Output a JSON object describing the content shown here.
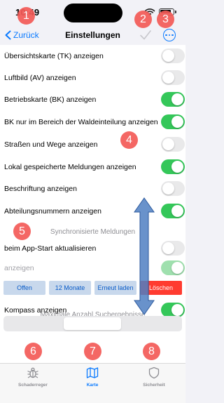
{
  "status_bar": {
    "time": "10:49"
  },
  "nav": {
    "back_label": "Zurück",
    "title": "Einstellungen"
  },
  "settings": [
    {
      "label": "Übersichtskarte (TK) anzeigen",
      "on": false
    },
    {
      "label": "Luftbild (AV) anzeigen",
      "on": false
    },
    {
      "label": "Betriebskarte (BK) anzeigen",
      "on": true
    },
    {
      "label": "BK nur im Bereich der Waldeinteilung anzeigen",
      "on": true
    },
    {
      "label": "Straßen und Wege anzeigen",
      "on": false
    },
    {
      "label": "Lokal gespeicherte Meldungen anzeigen",
      "on": true
    },
    {
      "label": "Beschriftung anzeigen",
      "on": false
    },
    {
      "label": "Abteilungsnummern anzeigen",
      "on": true
    }
  ],
  "sync": {
    "header": "Synchronisierte Meldungen",
    "rows": [
      {
        "label": "beim App-Start aktualisieren",
        "on": false
      },
      {
        "label": "anzeigen",
        "on": true
      }
    ],
    "buttons": [
      "Offen",
      "12 Monate",
      "Erneut laden",
      "Löschen"
    ]
  },
  "compass": {
    "label": "Kompass anzeigen",
    "on": true
  },
  "search_results": {
    "header": "Maximale Anzahl Suchergebnisse",
    "selected_index": 1
  },
  "tabs": [
    {
      "label": "Schaderreger",
      "icon": "bug-icon"
    },
    {
      "label": "Karte",
      "icon": "map-icon",
      "active": true
    },
    {
      "label": "Sicherheit",
      "icon": "shield-icon"
    }
  ],
  "annotations": [
    "1",
    "2",
    "3",
    "4",
    "5",
    "6",
    "7",
    "8"
  ],
  "colors": {
    "accent": "#0a7aff",
    "toggle_on": "#34c759",
    "danger": "#ff3b30",
    "badge": "#f45b57",
    "arrow": "#4f7fc2"
  }
}
